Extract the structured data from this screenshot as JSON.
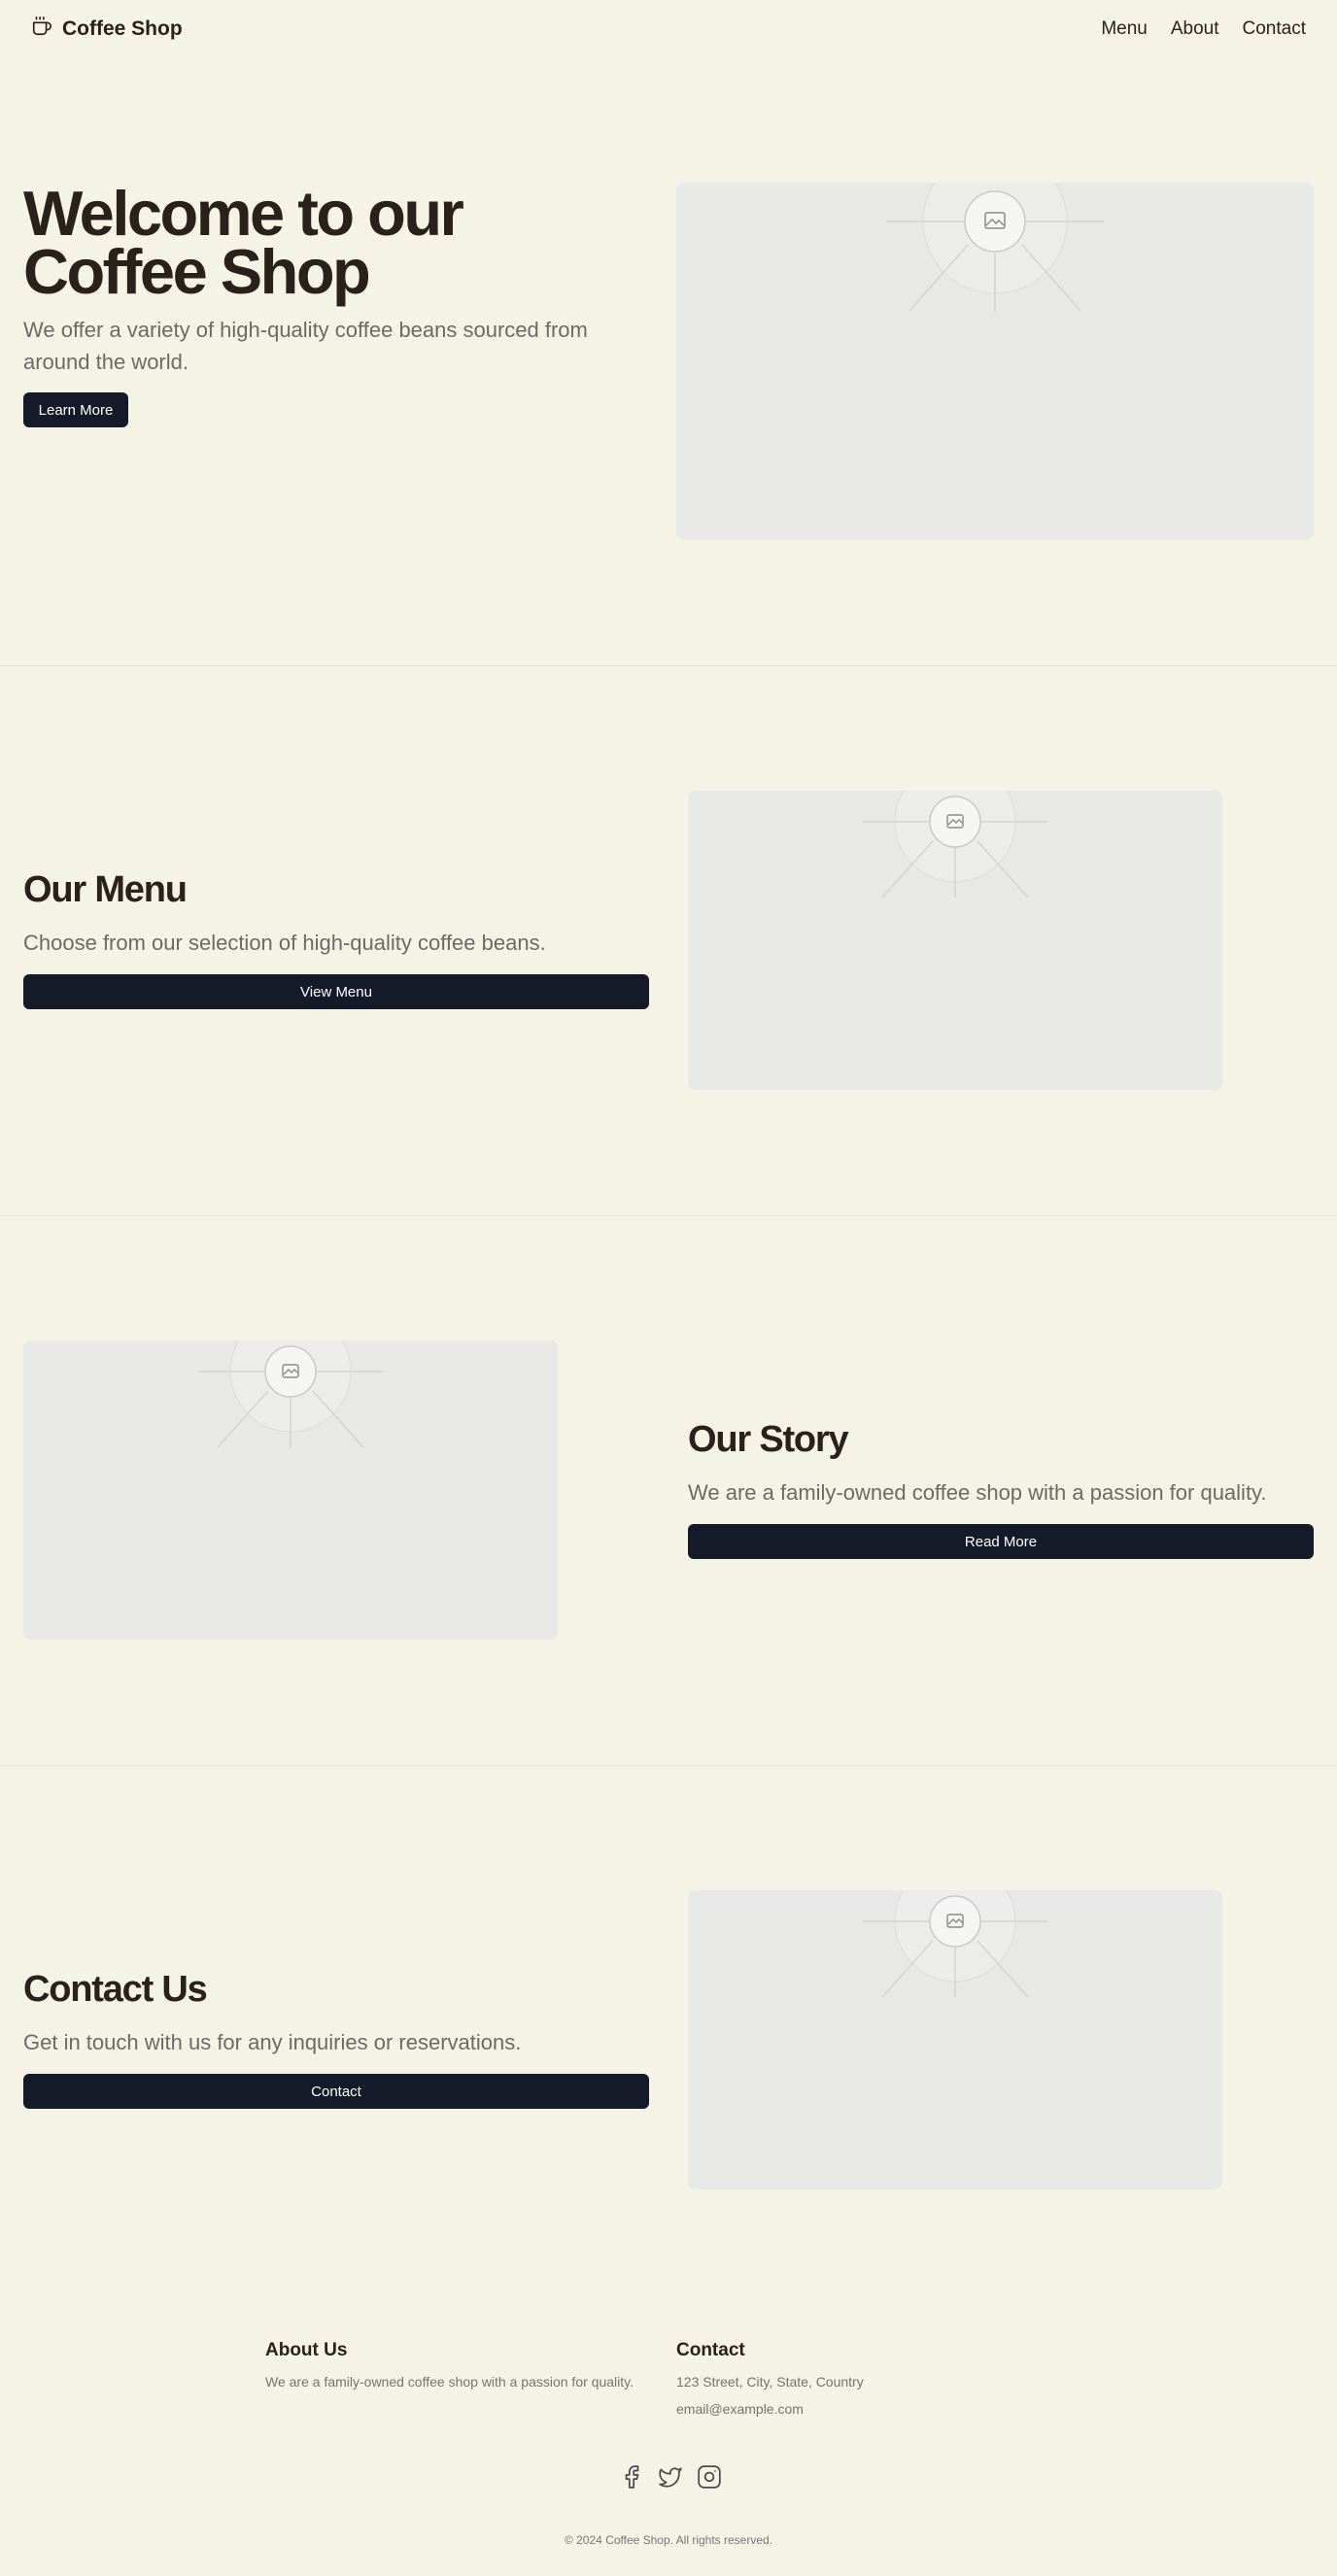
{
  "header": {
    "brand": "Coffee Shop",
    "brand_icon": "coffee-cup-icon",
    "nav": [
      "Menu",
      "About",
      "Contact"
    ]
  },
  "hero": {
    "title": "Welcome to our Coffee Shop",
    "subtitle": "We offer a variety of high-quality coffee beans sourced from around the world.",
    "button": "Learn More"
  },
  "menu_section": {
    "title": "Our Menu",
    "subtitle": "Choose from our selection of high-quality coffee beans.",
    "button": "View Menu"
  },
  "story_section": {
    "title": "Our Story",
    "subtitle": "We are a family-owned coffee shop with a passion for quality.",
    "button": "Read More"
  },
  "contact_section": {
    "title": "Contact Us",
    "subtitle": "Get in touch with us for any inquiries or reservations.",
    "button": "Contact"
  },
  "footer": {
    "about_title": "About Us",
    "about_text": "We are a family-owned coffee shop with a passion for quality.",
    "contact_title": "Contact",
    "address": "123 Street, City, State, Country",
    "email": "email@example.com",
    "social_icons": [
      "facebook-icon",
      "twitter-icon",
      "instagram-icon"
    ],
    "copyright": "© 2024 Coffee Shop. All rights reserved."
  },
  "colors": {
    "background": "#f5f2e6",
    "heading": "#2a211b",
    "muted_text": "#6d6a66",
    "button": "#151a28",
    "placeholder": "#e8e8e6"
  }
}
